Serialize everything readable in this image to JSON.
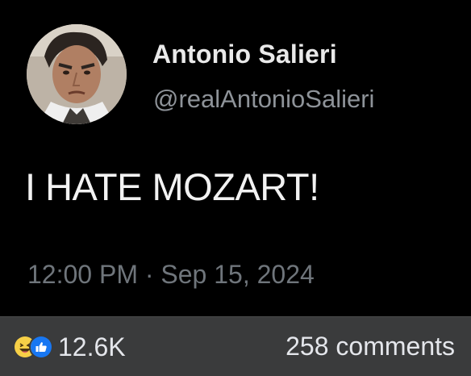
{
  "post": {
    "author": {
      "display_name": "Antonio Salieri",
      "handle": "@realAntonioSalieri"
    },
    "text": "I HATE MOZART!",
    "time": "12:00 PM",
    "separator": "·",
    "date": "Sep 15, 2024"
  },
  "footer": {
    "reactions": {
      "icons": [
        "laugh-emoji-icon",
        "like-thumb-icon"
      ],
      "count": "12.6K"
    },
    "comments_label": "258 comments"
  },
  "colors": {
    "background": "#000000",
    "footer_background": "#3a3b3c",
    "handle_text": "#8e9399",
    "meta_text": "#6f757b",
    "like_blue": "#1877f2",
    "laugh_yellow": "#f7d047"
  }
}
